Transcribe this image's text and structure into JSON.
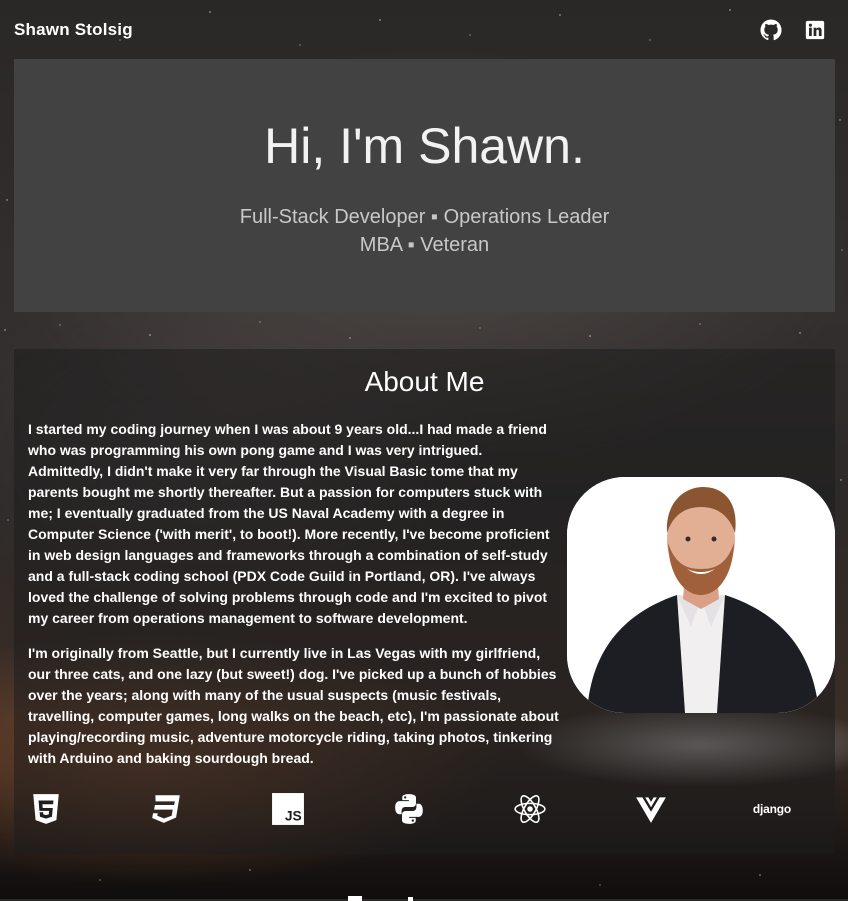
{
  "nav": {
    "brand": "Shawn Stolsig",
    "icons": [
      "github-icon",
      "linkedin-icon"
    ]
  },
  "hero": {
    "title": "Hi, I'm Shawn.",
    "subtitle_line1": "Full-Stack Developer ▪ Operations Leader",
    "subtitle_line2": "MBA ▪ Veteran"
  },
  "about": {
    "title": "About Me",
    "paragraphs": [
      "I started my coding journey when I was about 9 years old...I had made a friend who was programming his own pong game and I was very intrigued. Admittedly, I didn't make it very far through the Visual Basic tome that my parents bought me shortly thereafter. But a passion for computers stuck with me; I eventually graduated from the US Naval Academy with a degree in Computer Science ('with merit', to boot!). More recently, I've become proficient in web design languages and frameworks through a combination of self-study and a full-stack coding school (PDX Code Guild in Portland, OR). I've always loved the challenge of solving problems through code and I'm excited to pivot my career from operations management to software development.",
      "I'm originally from Seattle, but I currently live in Las Vegas with my girlfriend, our three cats, and one lazy (but sweet!) dog. I've picked up a bunch of hobbies over the years; along with many of the usual suspects (music festivals, travelling, computer games, long walks on the beach, etc), I'm passionate about playing/recording music, adventure motorcycle riding, taking photos, tinkering with Arduino and baking sourdough bread."
    ],
    "tech_icons": [
      "html5-icon",
      "css3-icon",
      "javascript-icon",
      "python-icon",
      "react-icon",
      "vue-icon",
      "django-icon"
    ],
    "django_label": "django"
  },
  "colors": {
    "hero_bg": "#424242",
    "photo_bg": "#ffffff",
    "text": "#ffffff"
  }
}
